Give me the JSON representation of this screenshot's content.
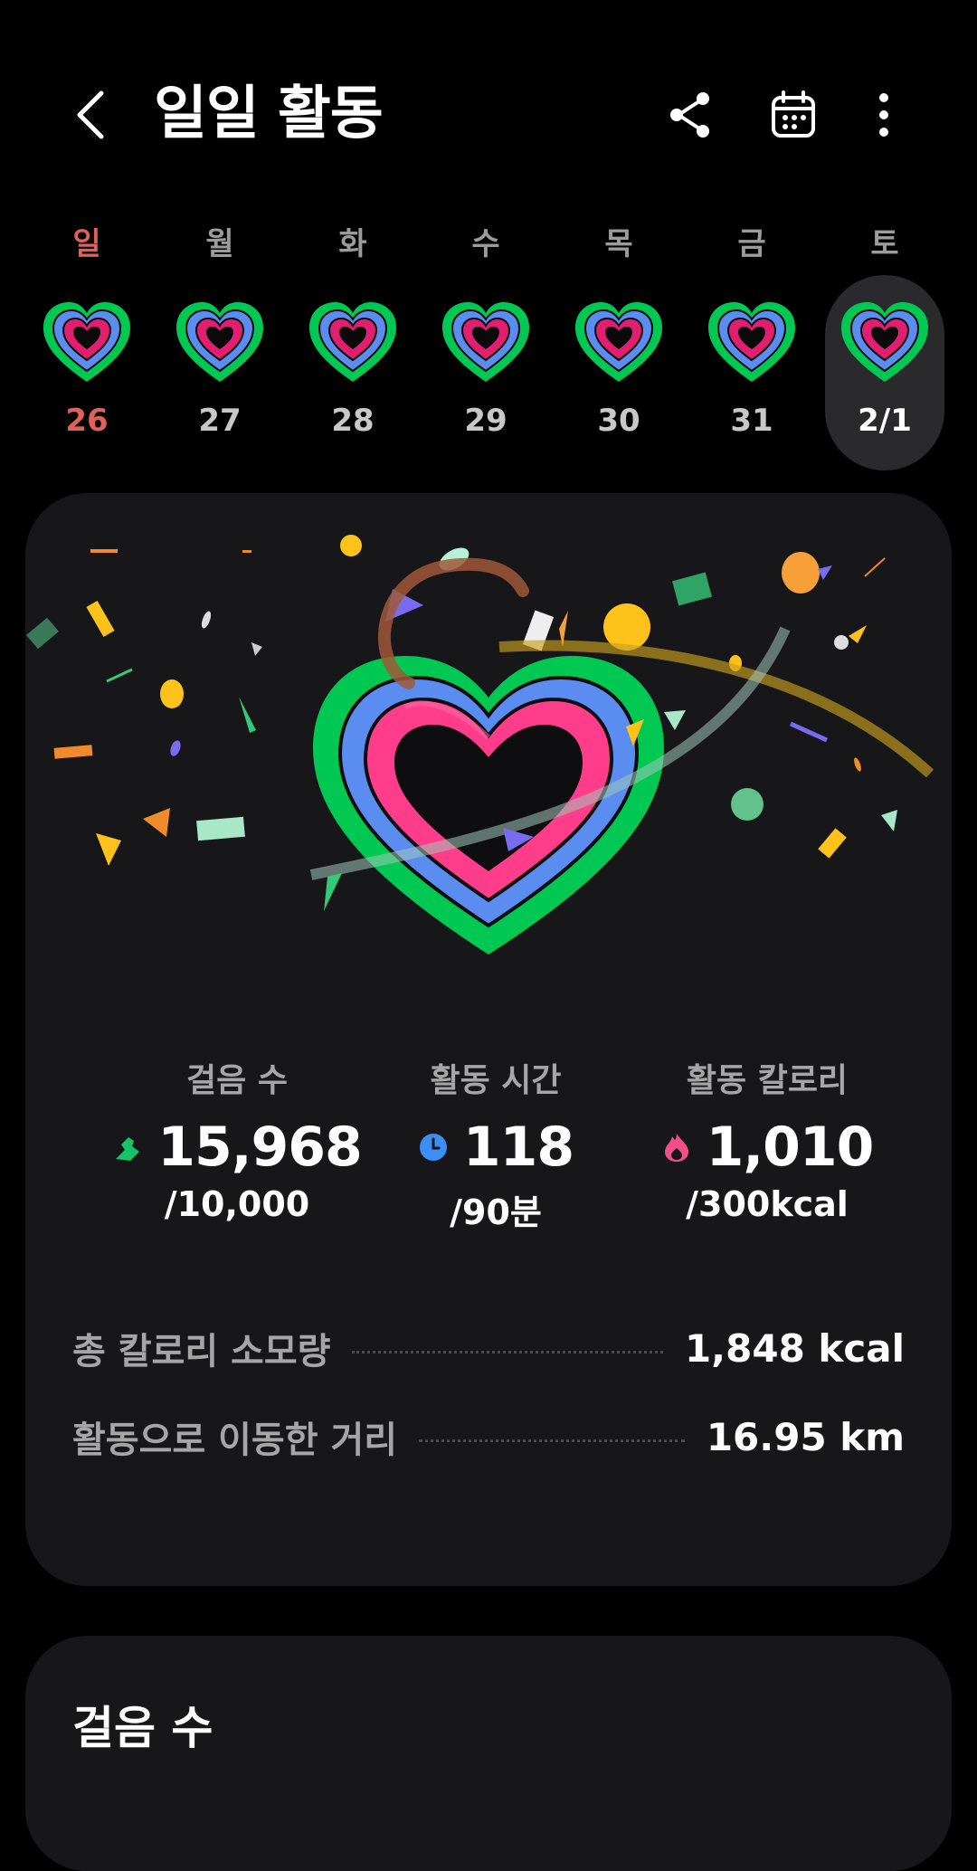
{
  "header": {
    "title": "일일 활동",
    "icons": [
      "back-arrow-icon",
      "share-icon",
      "calendar-icon",
      "more-vertical-icon"
    ]
  },
  "week": {
    "days": [
      {
        "name": "일",
        "date": "26",
        "sunday": true,
        "selected": false
      },
      {
        "name": "월",
        "date": "27",
        "sunday": false,
        "selected": false
      },
      {
        "name": "화",
        "date": "28",
        "sunday": false,
        "selected": false
      },
      {
        "name": "수",
        "date": "29",
        "sunday": false,
        "selected": false
      },
      {
        "name": "목",
        "date": "30",
        "sunday": false,
        "selected": false
      },
      {
        "name": "금",
        "date": "31",
        "sunday": false,
        "selected": false
      },
      {
        "name": "토",
        "date": "2/1",
        "sunday": false,
        "selected": true
      }
    ]
  },
  "stats": {
    "steps": {
      "label": "걸음 수",
      "value": "15,968",
      "goal": "/10,000"
    },
    "active_time": {
      "label": "활동 시간",
      "value": "118",
      "goal": "/90분"
    },
    "active_calories": {
      "label": "활동 칼로리",
      "value": "1,010",
      "goal": "/300kcal"
    }
  },
  "summary": {
    "total_calories": {
      "label": "총 칼로리 소모량",
      "value": "1,848 kcal"
    },
    "distance": {
      "label": "활동으로 이동한 거리",
      "value": "16.95 km"
    }
  },
  "steps_card": {
    "title": "걸음 수"
  },
  "colors": {
    "background": "#000000",
    "card": "#171719",
    "ring_outer": "#00c853",
    "ring_middle": "#5b8cf0",
    "ring_inner": "#e0206f",
    "sunday_red": "#e0605a",
    "steps_icon": "#14c46a",
    "time_icon": "#3a8ef5",
    "calorie_icon": "#f0508a"
  }
}
